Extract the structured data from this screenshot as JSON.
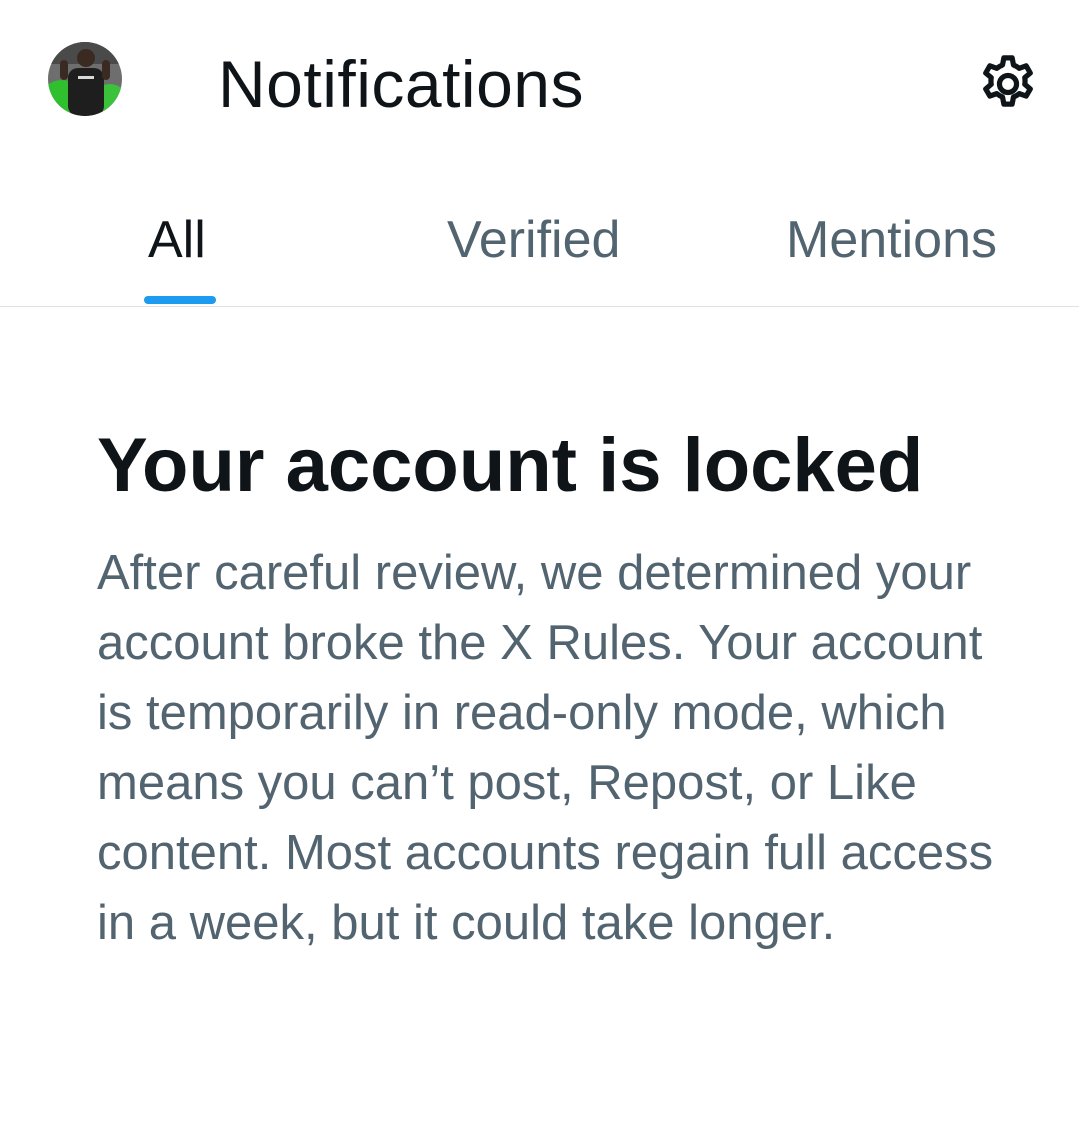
{
  "header": {
    "title": "Notifications",
    "avatar_icon": "user-avatar",
    "settings_icon": "gear-icon"
  },
  "tabs": [
    {
      "label": "All",
      "selected": true
    },
    {
      "label": "Verified",
      "selected": false
    },
    {
      "label": "Mentions",
      "selected": false
    }
  ],
  "notice": {
    "title": "Your account is locked",
    "body": "After careful review, we determined your account broke the X Rules. Your account is temporarily in read-only mode, which means you can’t post, Repost, or Like content. Most accounts regain full access in a week, but it could take longer."
  },
  "colors": {
    "accent": "#1d9bf0",
    "primary_text": "#0f1419",
    "secondary_text": "#536471",
    "divider": "#dfe3e6"
  }
}
